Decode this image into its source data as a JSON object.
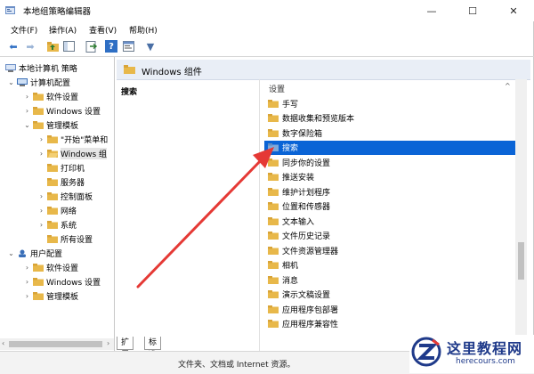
{
  "window": {
    "title": "本地组策略编辑器",
    "min_glyph": "—",
    "max_glyph": "☐",
    "close_glyph": "✕"
  },
  "menu": [
    "文件(F)",
    "操作(A)",
    "查看(V)",
    "帮助(H)"
  ],
  "toolbar": {
    "icons": [
      "back-arrow-icon",
      "forward-arrow-icon",
      "up-folder-icon",
      "show-hide-tree-icon",
      "export-list-icon",
      "help-icon",
      "properties-icon",
      "filter-icon"
    ],
    "help_glyph": "?",
    "filter_glyph": "▼",
    "back_glyph": "⬅",
    "forward_glyph": "➡"
  },
  "tree": {
    "items": [
      {
        "label": "本地计算机 策略",
        "expander": "",
        "icon": "computer-policy-icon"
      },
      {
        "label": "计算机配置",
        "expander": "⌄",
        "icon": "computer-config-icon"
      },
      {
        "label": "软件设置",
        "expander": "›",
        "icon": "folder-icon"
      },
      {
        "label": "Windows 设置",
        "expander": "›",
        "icon": "folder-icon"
      },
      {
        "label": "管理模板",
        "expander": "⌄",
        "icon": "folder-icon"
      },
      {
        "label": "\"开始\"菜单和",
        "expander": "›",
        "icon": "folder-icon"
      },
      {
        "label": "Windows 组",
        "expander": "›",
        "icon": "folder-icon"
      },
      {
        "label": "打印机",
        "expander": "",
        "icon": "folder-icon"
      },
      {
        "label": "服务器",
        "expander": "",
        "icon": "folder-icon"
      },
      {
        "label": "控制面板",
        "expander": "›",
        "icon": "folder-icon"
      },
      {
        "label": "网络",
        "expander": "›",
        "icon": "folder-icon"
      },
      {
        "label": "系统",
        "expander": "›",
        "icon": "folder-icon"
      },
      {
        "label": "所有设置",
        "expander": "",
        "icon": "folder-icon"
      },
      {
        "label": "用户配置",
        "expander": "⌄",
        "icon": "user-config-icon"
      },
      {
        "label": "软件设置",
        "expander": "›",
        "icon": "folder-icon"
      },
      {
        "label": "Windows 设置",
        "expander": "›",
        "icon": "folder-icon"
      },
      {
        "label": "管理模板",
        "expander": "›",
        "icon": "folder-icon"
      }
    ],
    "scroll_left": "‹",
    "scroll_right": "›"
  },
  "right_pane": {
    "header": "Windows 组件",
    "desc_title": "搜索",
    "column_header": "设置",
    "column_up": "^",
    "items": [
      {
        "label": "手写",
        "selected": false
      },
      {
        "label": "数据收集和预览版本",
        "selected": false
      },
      {
        "label": "数字保险箱",
        "selected": false
      },
      {
        "label": "搜索",
        "selected": true
      },
      {
        "label": "同步你的设置",
        "selected": false
      },
      {
        "label": "推送安装",
        "selected": false
      },
      {
        "label": "维护计划程序",
        "selected": false
      },
      {
        "label": "位置和传感器",
        "selected": false
      },
      {
        "label": "文本输入",
        "selected": false
      },
      {
        "label": "文件历史记录",
        "selected": false
      },
      {
        "label": "文件资源管理器",
        "selected": false
      },
      {
        "label": "相机",
        "selected": false
      },
      {
        "label": "消息",
        "selected": false
      },
      {
        "label": "演示文稿设置",
        "selected": false
      },
      {
        "label": "应用程序包部署",
        "selected": false
      },
      {
        "label": "应用程序兼容性",
        "selected": false
      }
    ]
  },
  "tabs": [
    "扩展",
    "标准"
  ],
  "bottom_text": "文件夹、文档或 Internet 资源。",
  "watermark": {
    "cn": "这里教程网",
    "en": "herecours.com"
  },
  "colors": {
    "selection": "#0a64d6",
    "folder": "#e8b84a",
    "arrow": "#e53935",
    "watermark": "#1f3a8a"
  }
}
